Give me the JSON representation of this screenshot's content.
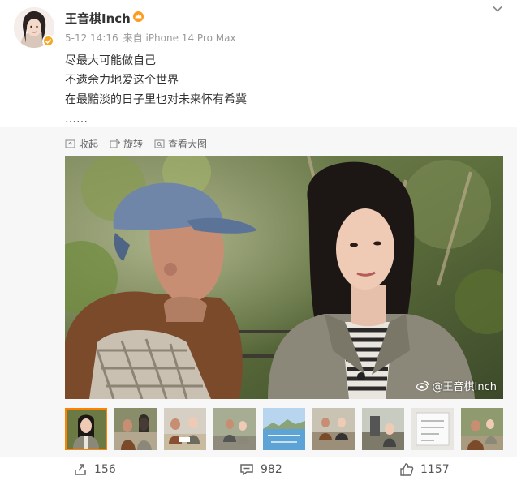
{
  "post": {
    "username": "王音棋Inch",
    "timestamp": "5-12 14:16",
    "source_prefix": "来自",
    "device": "iPhone 14 Pro Max",
    "lines": [
      "尽最大可能做自己",
      "不遗余力地爱这个世界",
      "在最黯淡的日子里也对未来怀有希冀",
      "……"
    ]
  },
  "toolbar": {
    "collapse": "收起",
    "rotate": "旋转",
    "view_large": "查看大图"
  },
  "image": {
    "watermark": "@王音棋Inch"
  },
  "thumbnails": {
    "count": 9,
    "active_index": 0
  },
  "actions": {
    "repost": "156",
    "comment": "982",
    "like": "1157"
  },
  "colors": {
    "accent": "#ff8200",
    "verify": "#f5a623"
  },
  "icons": [
    "crown-icon",
    "chevron-down-icon",
    "verified-icon",
    "collapse-icon",
    "rotate-icon",
    "view-large-icon",
    "weibo-icon",
    "repost-icon",
    "comment-icon",
    "like-icon"
  ]
}
